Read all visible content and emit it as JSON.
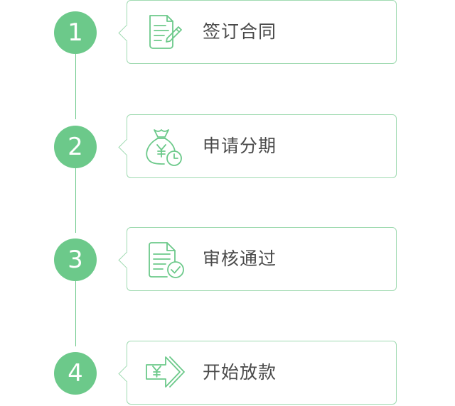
{
  "accent_color": "#6cc98a",
  "border_color": "#9fdab1",
  "steps": [
    {
      "number": "1",
      "label": "签订合同",
      "icon": "contract-sign-icon"
    },
    {
      "number": "2",
      "label": "申请分期",
      "icon": "money-bag-clock-icon"
    },
    {
      "number": "3",
      "label": "审核通过",
      "icon": "document-approved-icon"
    },
    {
      "number": "4",
      "label": "开始放款",
      "icon": "loan-transfer-icon"
    }
  ]
}
